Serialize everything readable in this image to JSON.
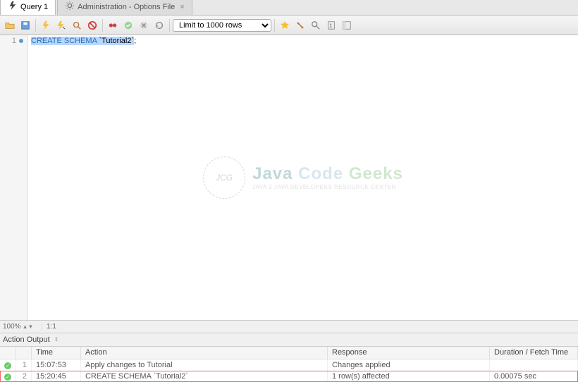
{
  "tabs": {
    "active": {
      "label": "Query 1"
    },
    "inactive": {
      "label": "Administration - Options File"
    }
  },
  "toolbar": {
    "limit_text": "Limit to 1000 rows",
    "icons": {
      "open": "folder-open-icon",
      "save": "save-icon",
      "execute": "lightning-icon",
      "execute_step": "lightning-cursor-icon",
      "explain": "explain-icon",
      "stop": "stop-icon",
      "commit": "commit-icon",
      "autocommit_on": "check-circle-icon",
      "autocommit_off": "x-circle-icon",
      "refresh": "refresh-icon",
      "favorite": "star-icon",
      "beautify": "beautify-icon",
      "find": "find-icon",
      "snippets": "snippets-icon",
      "panel": "panel-icon"
    }
  },
  "editor": {
    "line_num": "1",
    "code_keyword": "CREATE SCHEMA",
    "code_arg": " `Tutorial2`",
    "code_end": ";"
  },
  "watermark": {
    "logo": "JCG",
    "title1": "Java",
    "title2": "Code",
    "title3": "Geeks",
    "sub": "JAVA 2 JAVA DEVELOPERS RESOURCE CENTER"
  },
  "zoom": {
    "pct": "100%",
    "pos": "1:1"
  },
  "output": {
    "label": "Action Output",
    "columns": [
      "",
      "",
      "Time",
      "Action",
      "Response",
      "Duration / Fetch Time"
    ],
    "rows": [
      {
        "n": "1",
        "time": "15:07:53",
        "action": "Apply changes to Tutorial",
        "response": "Changes applied",
        "duration": ""
      },
      {
        "n": "2",
        "time": "15:20:45",
        "action": "CREATE SCHEMA `Tutorial2`",
        "response": "1 row(s) affected",
        "duration": "0.00075 sec"
      }
    ]
  }
}
